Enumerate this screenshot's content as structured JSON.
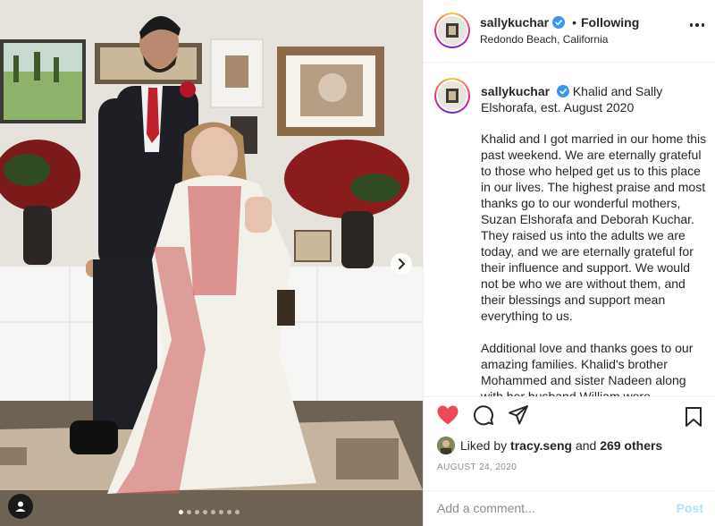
{
  "header": {
    "username": "sallykuchar",
    "separator": "•",
    "follow_label": "Following",
    "location": "Redondo Beach, California"
  },
  "caption": {
    "username": "sallykuchar",
    "headline": "Khalid and Sally Elshorafa, est. August 2020",
    "paragraphs": [
      "Khalid and I got married in our home this past weekend. We are eternally grateful to those who helped get us to this place in our lives. The highest praise and most thanks go to our wonderful mothers, Suzan Elshorafa and Deborah Kuchar. They raised us into the adults we are today, and we are eternally grateful for their influence and support. We would not be who we are without them, and their blessings and support mean everything to us.",
      "Additional love and thanks goes to our amazing families. Khalid's brother Mohammed and sister Nadeen along with her husband William were"
    ]
  },
  "likes": {
    "prefix": "Liked by",
    "user": "tracy.seng",
    "joiner": "and",
    "others": "269 others"
  },
  "date": "AUGUST 24, 2020",
  "comment": {
    "placeholder": "Add a comment...",
    "post_label": "Post"
  },
  "carousel": {
    "total_slides": 8,
    "current_index": 0
  },
  "icons": {
    "like": "heart-icon",
    "comment": "comment-icon",
    "share": "paper-plane-icon",
    "save": "bookmark-icon",
    "verified": "verified-badge-icon",
    "more": "more-options-icon",
    "next": "chevron-right-icon",
    "tags": "user-tag-icon"
  },
  "colors": {
    "liked_heart": "#ed4956",
    "verified": "#3897f0",
    "post_disabled": "#b2dffc",
    "secondary_text": "#8e8e8e"
  }
}
